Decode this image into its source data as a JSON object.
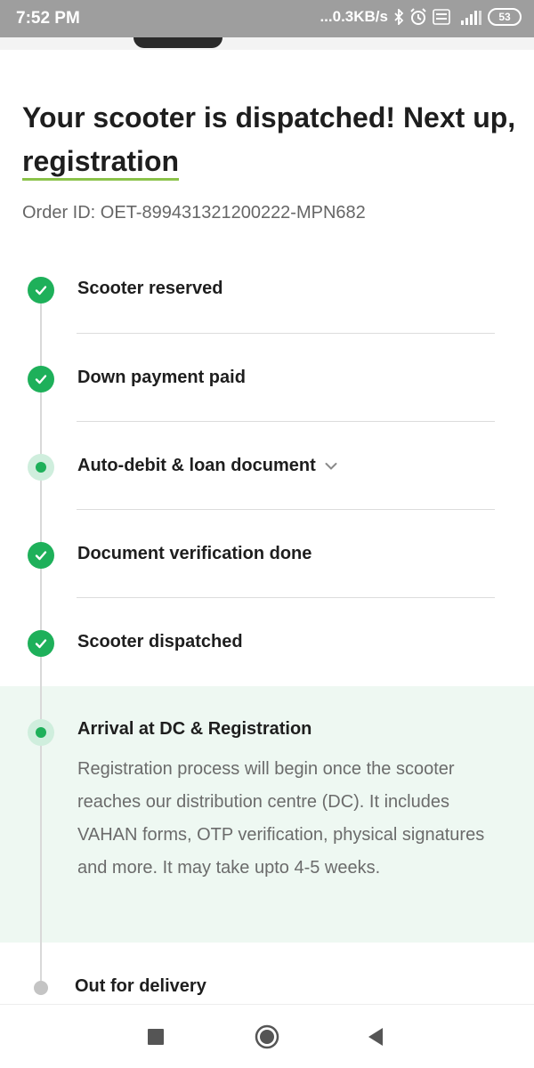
{
  "status_bar": {
    "time": "7:52 PM",
    "network_speed": "...0.3KB/s",
    "battery": "53",
    "icons": [
      "bluetooth-icon",
      "alarm-icon",
      "volte-icon",
      "signal-4g-icon",
      "battery-icon"
    ]
  },
  "header": {
    "title_main": "Your scooter is dispatched! Next up, ",
    "title_accent": "registration",
    "order_id": "Order ID: OET-899431321200222-MPN682"
  },
  "steps": [
    {
      "label": "Scooter reserved",
      "status": "done"
    },
    {
      "label": "Down payment paid",
      "status": "done"
    },
    {
      "label": "Auto-debit & loan document",
      "status": "active",
      "expandable": true
    },
    {
      "label": "Document verification done",
      "status": "done"
    },
    {
      "label": "Scooter dispatched",
      "status": "done"
    },
    {
      "label": "Arrival at DC & Registration",
      "status": "active",
      "description": "Registration process will begin once the scooter reaches our distribution centre (DC). It includes VAHAN forms, OTP verification, physical signatures and more. It may take upto 4-5 weeks."
    },
    {
      "label": "Out for delivery",
      "status": "pending"
    }
  ],
  "colors": {
    "accent_green": "#1eb05a",
    "underline_green": "#8bc34a",
    "highlight_bg": "#eef8f2",
    "status_bar_bg": "#9e9e9e"
  },
  "nav": {
    "icons": [
      "recents-square-icon",
      "home-circle-icon",
      "back-triangle-icon"
    ]
  }
}
